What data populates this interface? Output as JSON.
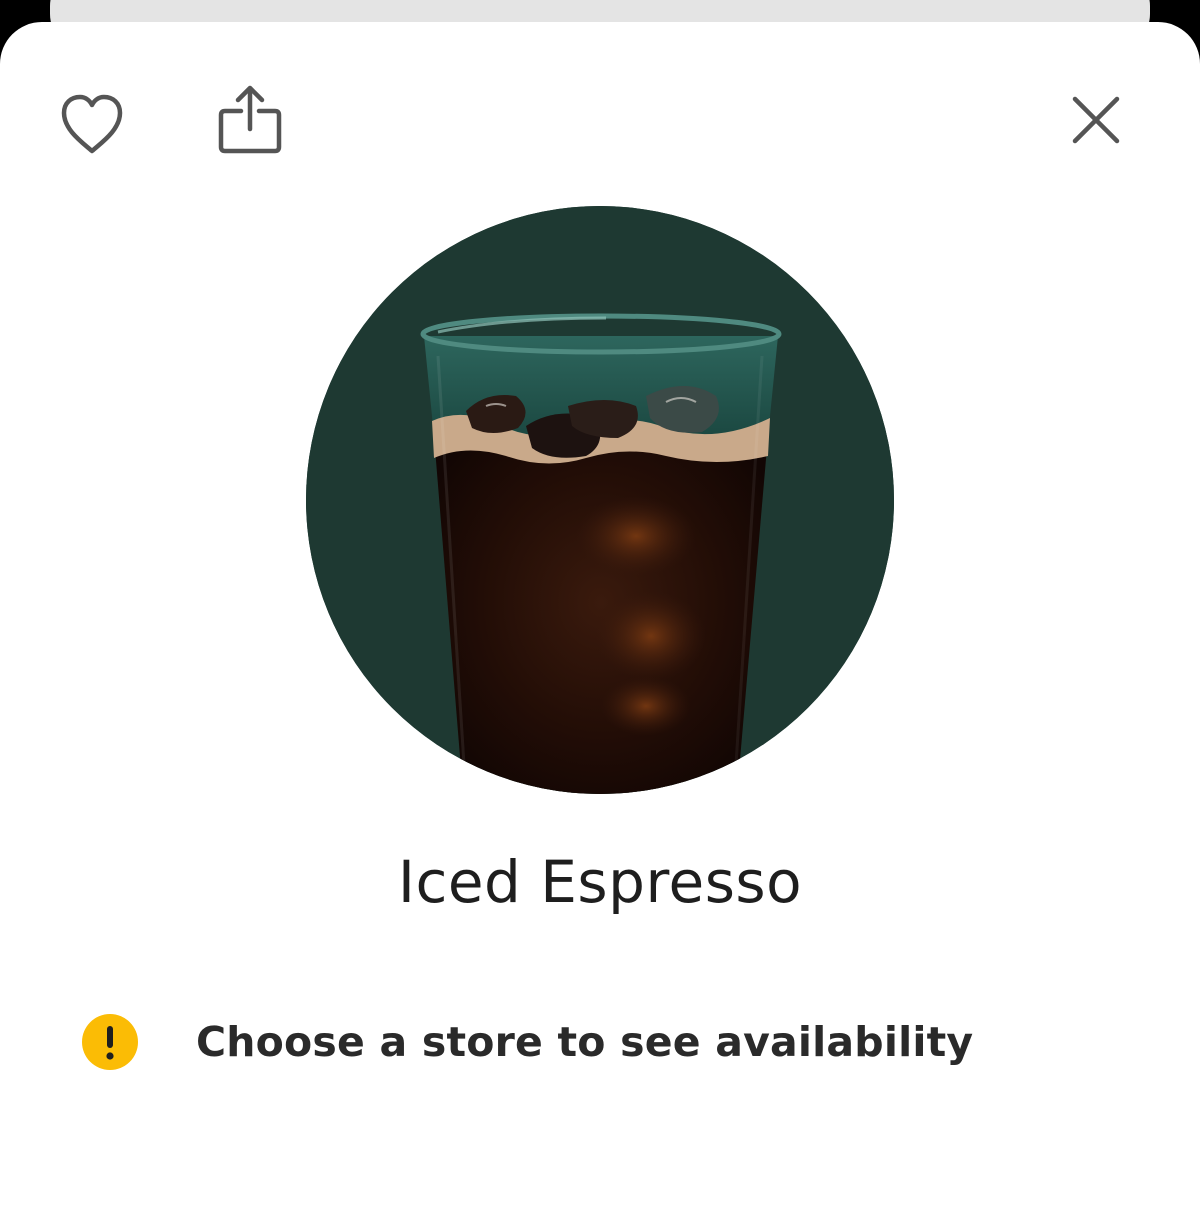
{
  "header": {
    "favorite_icon": "heart-icon",
    "share_icon": "share-icon",
    "close_icon": "close-icon"
  },
  "product": {
    "name": "Iced Espresso",
    "image": "iced-espresso-glass",
    "image_background": "#1e3932"
  },
  "availability": {
    "icon": "warning-icon",
    "icon_color": "#fbbc05",
    "text": "Choose a store to see availability"
  }
}
